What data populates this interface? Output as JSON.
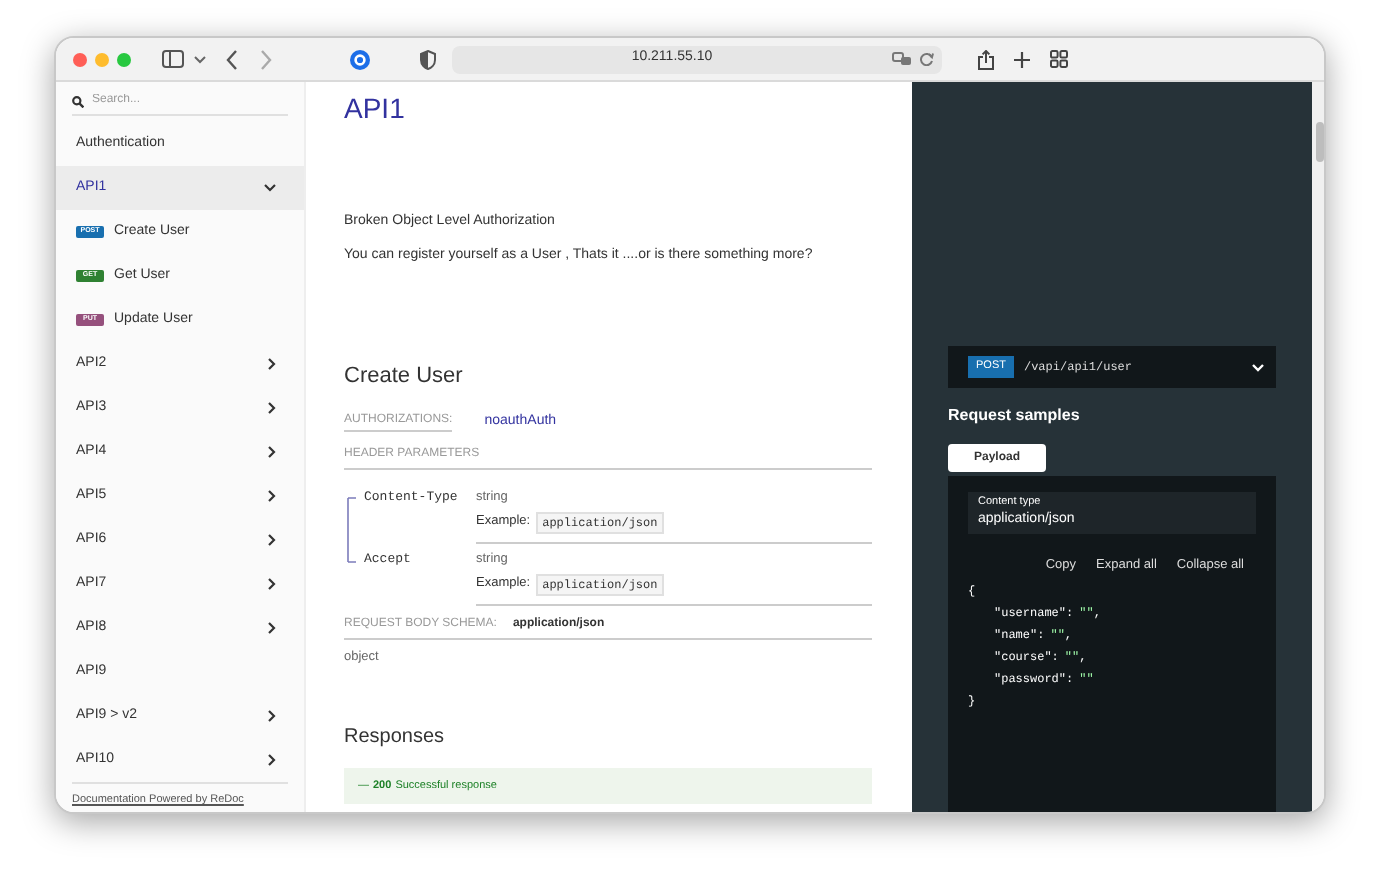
{
  "browser": {
    "url": "10.211.55.10"
  },
  "sidebar": {
    "search": {
      "placeholder": "Search..."
    },
    "items": [
      {
        "kind": "group",
        "label": "Authentication",
        "selected": false
      },
      {
        "kind": "group",
        "label": "API1",
        "selected": true,
        "expanded": true,
        "children": [
          {
            "kind": "operation",
            "method": "POST",
            "color": "#186faf",
            "label": "Create User",
            "selected": false
          },
          {
            "kind": "operation",
            "method": "GET",
            "color": "#2f8132",
            "label": "Get User",
            "selected": false
          },
          {
            "kind": "operation",
            "method": "PUT",
            "color": "#95507c",
            "label": "Update User",
            "selected": false
          }
        ]
      },
      {
        "kind": "group",
        "label": "API2",
        "selected": false,
        "expanded": false
      },
      {
        "kind": "group",
        "label": "API3",
        "selected": false,
        "expanded": false
      },
      {
        "kind": "group",
        "label": "API4",
        "selected": false,
        "expanded": false
      },
      {
        "kind": "group",
        "label": "API5",
        "selected": false,
        "expanded": false
      },
      {
        "kind": "group",
        "label": "API6",
        "selected": false,
        "expanded": false
      },
      {
        "kind": "group",
        "label": "API7",
        "selected": false,
        "expanded": false
      },
      {
        "kind": "group",
        "label": "API8",
        "selected": false,
        "expanded": false
      },
      {
        "kind": "group",
        "label": "API9",
        "selected": false
      },
      {
        "kind": "group",
        "label": "API9 > v2",
        "selected": false,
        "expanded": false
      },
      {
        "kind": "group",
        "label": "API10",
        "selected": false,
        "expanded": false
      }
    ],
    "footer": "Documentation Powered by ReDoc"
  },
  "main": {
    "title": "API1",
    "paragraphs": [
      "Broken Object Level Authorization",
      "You can register yourself as a User , Thats it ....or is there something more?"
    ],
    "operation": {
      "title": "Create User",
      "authorizations_label": "AUTHORIZATIONS:",
      "authorizations_value": "noauthAuth",
      "header_parameters_label": "HEADER PARAMETERS",
      "parameters": [
        {
          "name": "Content-Type",
          "type": "string",
          "example_label": "Example:",
          "example": "application/json"
        },
        {
          "name": "Accept",
          "type": "string",
          "example_label": "Example:",
          "example": "application/json"
        }
      ],
      "request_body_label": "REQUEST BODY SCHEMA:",
      "request_body_value": "application/json",
      "schema_type": "object",
      "responses_title": "Responses",
      "responses": [
        {
          "code": "200",
          "text": "Successful response",
          "toggle": "—"
        }
      ]
    }
  },
  "samples": {
    "method": "POST",
    "path": "/vapi/api1/user",
    "title": "Request samples",
    "tabs": [
      {
        "label": "Payload",
        "selected": true
      }
    ],
    "content_type_label": "Content type",
    "content_type_value": "application/json",
    "actions": [
      "Copy",
      "Expand all",
      "Collapse all"
    ],
    "open": "{",
    "fields": [
      {
        "key": "\"username\":",
        "value": "\"\"",
        "after": ","
      },
      {
        "key": "\"name\":",
        "value": "\"\"",
        "after": ","
      },
      {
        "key": "\"course\":",
        "value": "\"\"",
        "after": ","
      },
      {
        "key": "\"password\":",
        "value": "\"\""
      }
    ],
    "close": "}"
  }
}
